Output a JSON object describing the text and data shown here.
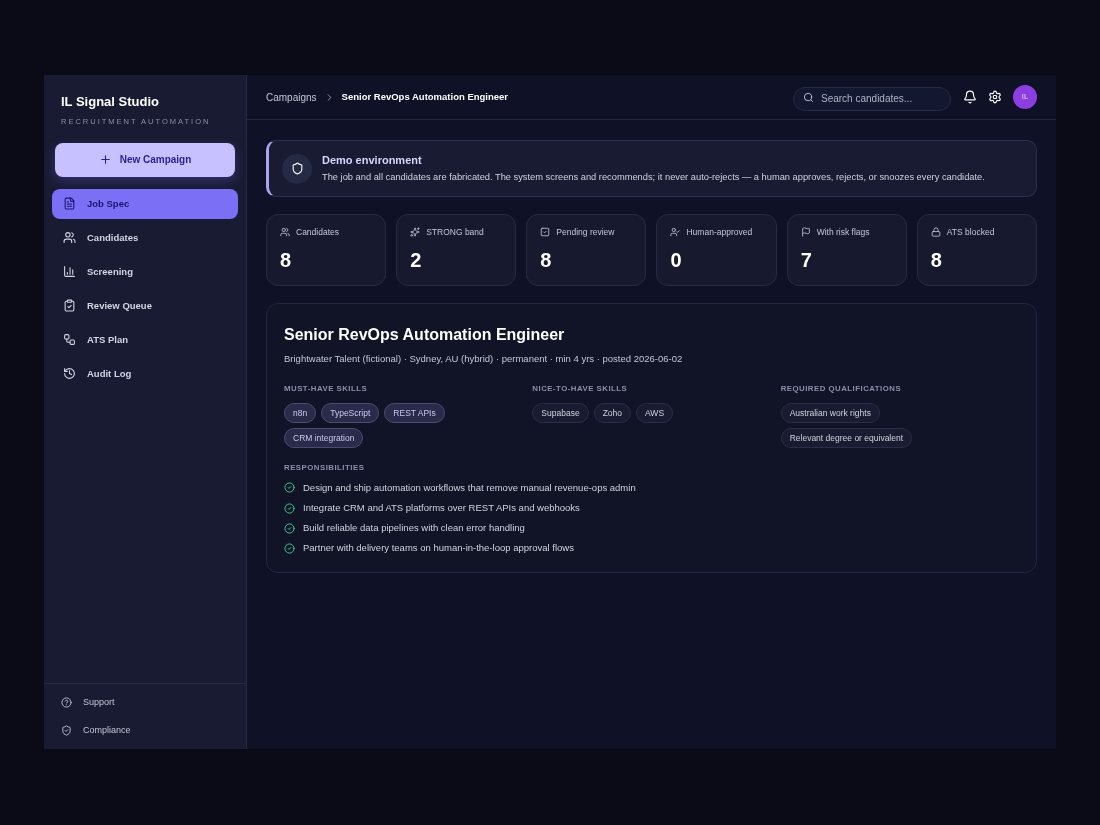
{
  "sidebar": {
    "brand": "IL Signal Studio",
    "tagline": "RECRUITMENT AUTOMATION",
    "new_button": "New Campaign",
    "items": [
      {
        "label": "Job Spec",
        "selected": true
      },
      {
        "label": "Candidates",
        "selected": false
      },
      {
        "label": "Screening",
        "selected": false
      },
      {
        "label": "Review Queue",
        "selected": false
      },
      {
        "label": "ATS Plan",
        "selected": false
      },
      {
        "label": "Audit Log",
        "selected": false
      }
    ],
    "footer_items": [
      "Support",
      "Compliance"
    ]
  },
  "header": {
    "breadcrumb": [
      "Campaigns",
      "Senior RevOps Automation Engineer"
    ],
    "search": {
      "placeholder": "Search candidates..."
    },
    "avatar": "IL"
  },
  "notice": {
    "title": "Demo environment",
    "text": "The job and all candidates are fabricated. The system screens and recommends; it never auto-rejects — a human approves, rejects, or snoozes every candidate."
  },
  "stats": [
    {
      "label": "Candidates",
      "value": "8"
    },
    {
      "label": "STRONG band",
      "value": "2"
    },
    {
      "label": "Pending review",
      "value": "8"
    },
    {
      "label": "Human-approved",
      "value": "0"
    },
    {
      "label": "With risk flags",
      "value": "7"
    },
    {
      "label": "ATS blocked",
      "value": "8"
    }
  ],
  "job": {
    "title": "Senior RevOps Automation Engineer",
    "meta": "Brightwater Talent (fictional) · Sydney, AU (hybrid) · permanent · min 4 yrs · posted 2026-06-02",
    "groups": [
      {
        "heading": "MUST-HAVE SKILLS",
        "kind": "accent",
        "chips": [
          "n8n",
          "TypeScript",
          "REST APIs",
          "CRM integration"
        ]
      },
      {
        "heading": "NICE-TO-HAVE SKILLS",
        "kind": "plain",
        "chips": [
          "Supabase",
          "Zoho",
          "AWS"
        ]
      },
      {
        "heading": "REQUIRED QUALIFICATIONS",
        "kind": "plain",
        "chips": [
          "Australian work rights",
          "Relevant degree or equivalent"
        ]
      }
    ],
    "responsibilities_heading": "RESPONSIBILITIES",
    "responsibilities": [
      "Design and ship automation workflows that remove manual revenue-ops admin",
      "Integrate CRM and ATS platforms over REST APIs and webhooks",
      "Build reliable data pipelines with clean error handling",
      "Partner with delivery teams on human-in-the-loop approval flows"
    ]
  }
}
